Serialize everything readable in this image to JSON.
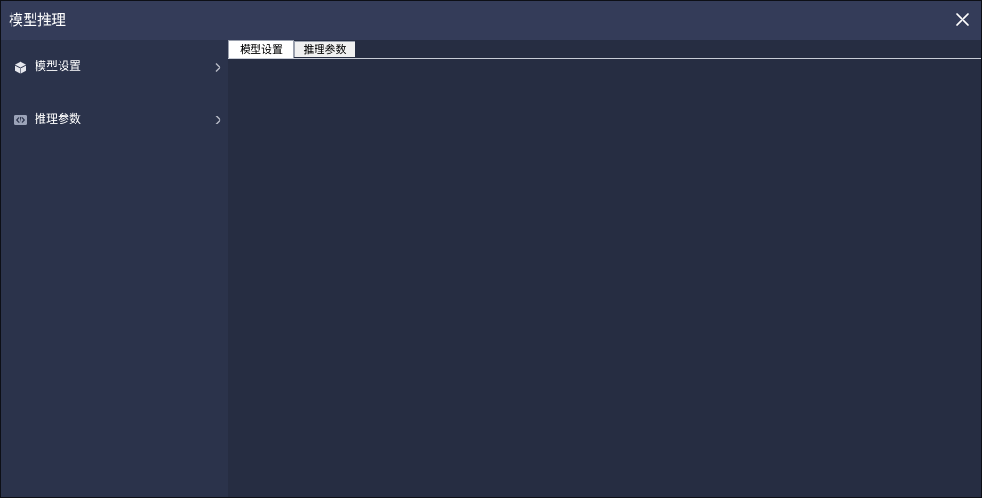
{
  "window": {
    "title": "模型推理"
  },
  "sidebar": {
    "items": [
      {
        "label": "模型设置",
        "icon": "cube-icon"
      },
      {
        "label": "推理参数",
        "icon": "code-icon"
      }
    ]
  },
  "tabs": [
    {
      "label": "模型设置",
      "active": true
    },
    {
      "label": "推理参数",
      "active": false
    }
  ],
  "colors": {
    "titlebar": "#343c59",
    "sidebar": "#2b334b",
    "content": "#262d42"
  }
}
